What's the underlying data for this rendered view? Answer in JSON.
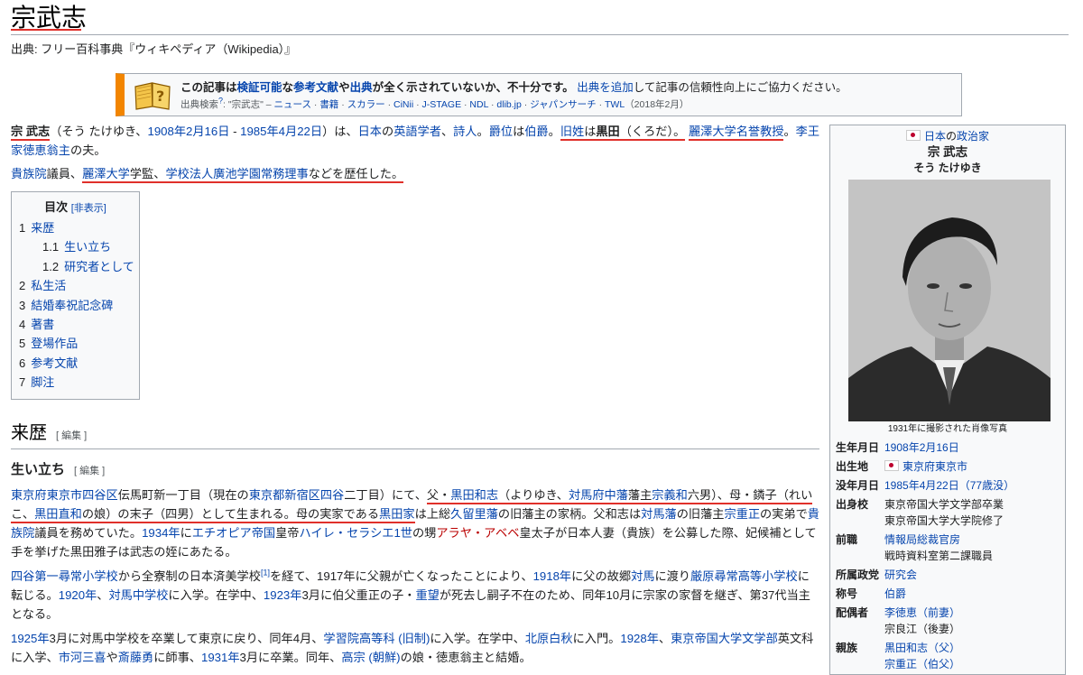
{
  "page": {
    "title": "宗武志",
    "source": "出典: フリー百科事典『ウィキペディア（Wikipedia）』"
  },
  "ambox": {
    "m1": "この記事は",
    "m2": "検証可能",
    "m3": "な",
    "m4": "参考文献",
    "m5": "や",
    "m6": "出典",
    "m7": "が全く示されていないか、不十分です。",
    "m8": "出典を追加",
    "m9": "して記事の信頼性向上にご協力ください。",
    "sub1": "出典検索",
    "sub2": "?",
    "sub3": ": \"宗武志\" – ",
    "links": [
      "ニュース",
      "書籍",
      "スカラー",
      "CiNii",
      "J-STAGE",
      "NDL",
      "dlib.jp",
      "ジャパンサーチ",
      "TWL"
    ],
    "sep": " · ",
    "date": "（2018年2月）"
  },
  "intro": {
    "p1": [
      "宗 武志",
      "（そう たけゆき、",
      "1908年",
      "2月16日",
      " - ",
      "1985年",
      "4月22日",
      "）は、",
      "日本",
      "の",
      "英語学者",
      "、",
      "詩人",
      "。",
      "爵位",
      "は",
      "伯爵",
      "。",
      "旧姓",
      "は",
      "黒田",
      "（くろだ）。",
      "麗澤大学",
      "名誉教授",
      "。",
      "李王家",
      "徳恵翁主",
      "の夫。"
    ],
    "p2": [
      "貴族院",
      "議員、",
      "麗澤大学",
      "学監、",
      "学校法人廣池学園",
      "常務理事",
      "などを歴任した。"
    ]
  },
  "toc": {
    "title": "目次",
    "toggle": "[非表示]",
    "items": [
      {
        "num": "1",
        "label": "来歴"
      },
      {
        "num": "1.1",
        "label": "生い立ち"
      },
      {
        "num": "1.2",
        "label": "研究者として"
      },
      {
        "num": "2",
        "label": "私生活"
      },
      {
        "num": "3",
        "label": "結婚奉祝記念碑"
      },
      {
        "num": "4",
        "label": "著書"
      },
      {
        "num": "5",
        "label": "登場作品"
      },
      {
        "num": "6",
        "label": "参考文献"
      },
      {
        "num": "7",
        "label": "脚注"
      }
    ]
  },
  "section": {
    "h2": "来歴",
    "h3": "生い立ち",
    "edit": "[ 編集 ]",
    "p1": [
      "東京府",
      "東京市",
      "四谷区",
      "伝馬町新一丁目（現在の",
      "東京都",
      "新宿区",
      "四谷",
      "二丁目）にて、",
      "父・",
      "黒田和志",
      "（よりゆき、",
      "対馬府中藩",
      "藩主",
      "宗義和",
      "六男）、",
      "母・鏻子（れいこ、",
      "黒田直和",
      "の娘）の末子（四男）として生まれる。",
      "母の実家である",
      "黒田家",
      "は上総",
      "久留里藩",
      "の旧藩主の家柄。父和志は",
      "対馬藩",
      "の旧藩主",
      "宗重正",
      "の実弟で",
      "貴族院",
      "議員を務めていた。",
      "1934年",
      "に",
      "エチオピア帝国",
      "皇帝",
      "ハイレ・セラシエ1世",
      "の甥",
      "アラヤ・アベベ",
      "皇太子が日本人妻（貴族）を公募した際、妃候補として手を挙げた黒田雅子は武志の姪にあたる。"
    ],
    "p2": [
      "四谷第一尋常小学校",
      "から全寮制の日本済美学校",
      "[1]",
      "を経て、1917年に父親が亡くなったことにより、",
      "1918年",
      "に父の故郷",
      "対馬",
      "に渡り",
      "厳原尋常高等小学校",
      "に転じる。",
      "1920年",
      "、",
      "対馬中学校",
      "に入学。在学中、",
      "1923年",
      "3月に伯父重正の子・",
      "重望",
      "が死去し嗣子不在のため、同年10月に宗家の家督を継ぎ、第37代当主となる。"
    ],
    "p3": [
      "1925年",
      "3月に対馬中学校を卒業して東京に戻り、同年4月、",
      "学習院高等科 (旧制)",
      "に入学。在学中、",
      "北原白秋",
      "に入門。",
      "1928年",
      "、",
      "東京帝国大学",
      "文学部",
      "英文科に入学、",
      "市河三喜",
      "や",
      "斎藤勇",
      "に師事、",
      "1931年",
      "3月に卒業。同年、",
      "高宗 (朝鮮)",
      "の娘・徳恵翁主と結婚。"
    ]
  },
  "infobox": {
    "country": "日本",
    "country_suffix": "の",
    "role": "政治家",
    "name": "宗 武志",
    "reading": "そう たけゆき",
    "caption": "1931年に撮影された肖像写真",
    "rows": [
      {
        "k": "生年月日",
        "v": [
          "1908年2月16日"
        ]
      },
      {
        "k": "出生地",
        "v": [
          "東京府東京市"
        ]
      },
      {
        "k": "没年月日",
        "v": [
          "1985年4月22日（77歳没）"
        ]
      },
      {
        "k": "出身校",
        "v": [
          "東京帝国大学文学部卒業",
          "東京帝国大学大学院修了"
        ]
      },
      {
        "k": "前職",
        "v": [
          "情報局総裁官房",
          "戦時資料室第二課職員"
        ]
      },
      {
        "k": "所属政党",
        "v": [
          "研究会"
        ]
      },
      {
        "k": "称号",
        "v": [
          "伯爵"
        ]
      },
      {
        "k": "配偶者",
        "v": [
          "李徳恵（前妻）",
          "宗良江（後妻）"
        ]
      },
      {
        "k": "親族",
        "v": [
          "黒田和志（父）",
          "宗重正（伯父）"
        ]
      }
    ]
  },
  "colors": {
    "link": "#0645ad",
    "redlink": "#ba0000",
    "annotation": "#e0302a",
    "warning": "#f28500"
  }
}
